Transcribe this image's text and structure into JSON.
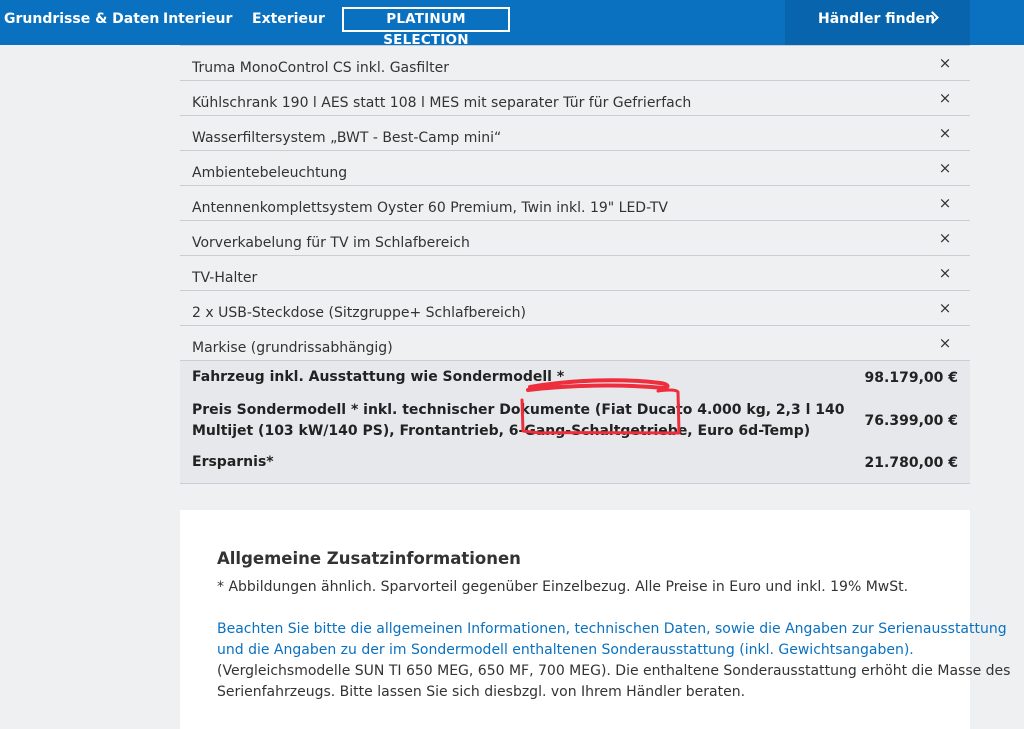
{
  "nav": {
    "items": [
      "Grundrisse & Daten",
      "Interieur",
      "Exterieur"
    ],
    "highlight_label": "PLATINUM SELECTION",
    "dealer_label": "Händler finden",
    "dealer_icon": "chevron-right-icon",
    "background_color": "#0a71c0"
  },
  "options": [
    {
      "label": "Truma MonoControl CS inkl. Gasfilter",
      "remove": "×"
    },
    {
      "label": "Kühlschrank 190 l AES statt 108 l MES mit separater Tür für Gefrierfach",
      "remove": "×"
    },
    {
      "label": "Wasserfiltersystem „BWT - Best-Camp mini“",
      "remove": "×"
    },
    {
      "label": "Ambientebeleuchtung",
      "remove": "×"
    },
    {
      "label": "Antennenkomplettsystem Oyster 60 Premium, Twin inkl. 19\" LED-TV",
      "remove": "×"
    },
    {
      "label": "Vorverkabelung für TV im Schlafbereich",
      "remove": "×"
    },
    {
      "label": "TV-Halter",
      "remove": "×"
    },
    {
      "label": "2 x USB-Steckdose (Sitzgruppe+ Schlafbereich)",
      "remove": "×"
    },
    {
      "label": "Markise (grundrissabhängig)",
      "remove": "×"
    }
  ],
  "summary": {
    "vehicle_label": "Fahrzeug inkl. Ausstattung wie Sondermodell *",
    "vehicle_value": "98.179,00 €",
    "special_label_line1": "Preis Sondermodell * inkl. technischer Dokumente (Fiat Ducato 4.000 kg, 2,3 l 140",
    "special_label_line2": "Multijet (103 kW/140 PS), Frontantrieb, 6-Gang-Schaltgetriebe, Euro 6d-Temp)",
    "special_value": "76.399,00 €",
    "savings_label": "Ersparnis*",
    "savings_value": "21.780,00 €"
  },
  "info": {
    "title": "Allgemeine Zusatzinformationen",
    "footnote": "* Abbildungen ähnlich. Sparvorteil gegenüber Einzelbezug. Alle Preise in Euro und inkl. 19% MwSt.",
    "link_line1": "Beachten Sie bitte die allgemeinen Informationen, technischen Daten, sowie die Angaben zur Serienausstattung",
    "link_line2": "und die Angaben zu der im Sondermodell enthaltenen Sonderausstattung (inkl. Gewichtsangaben).",
    "text_line1": "(Vergleichsmodelle SUN TI 650 MEG, 650 MF, 700 MEG). Die enthaltene Sonderausstattung erhöht die Masse des",
    "text_line2": "Serienfahrzeugs. Bitte lassen Sie sich diesbzgl. von Ihrem Händler beraten."
  },
  "annotation_color": "#ee2e3c"
}
